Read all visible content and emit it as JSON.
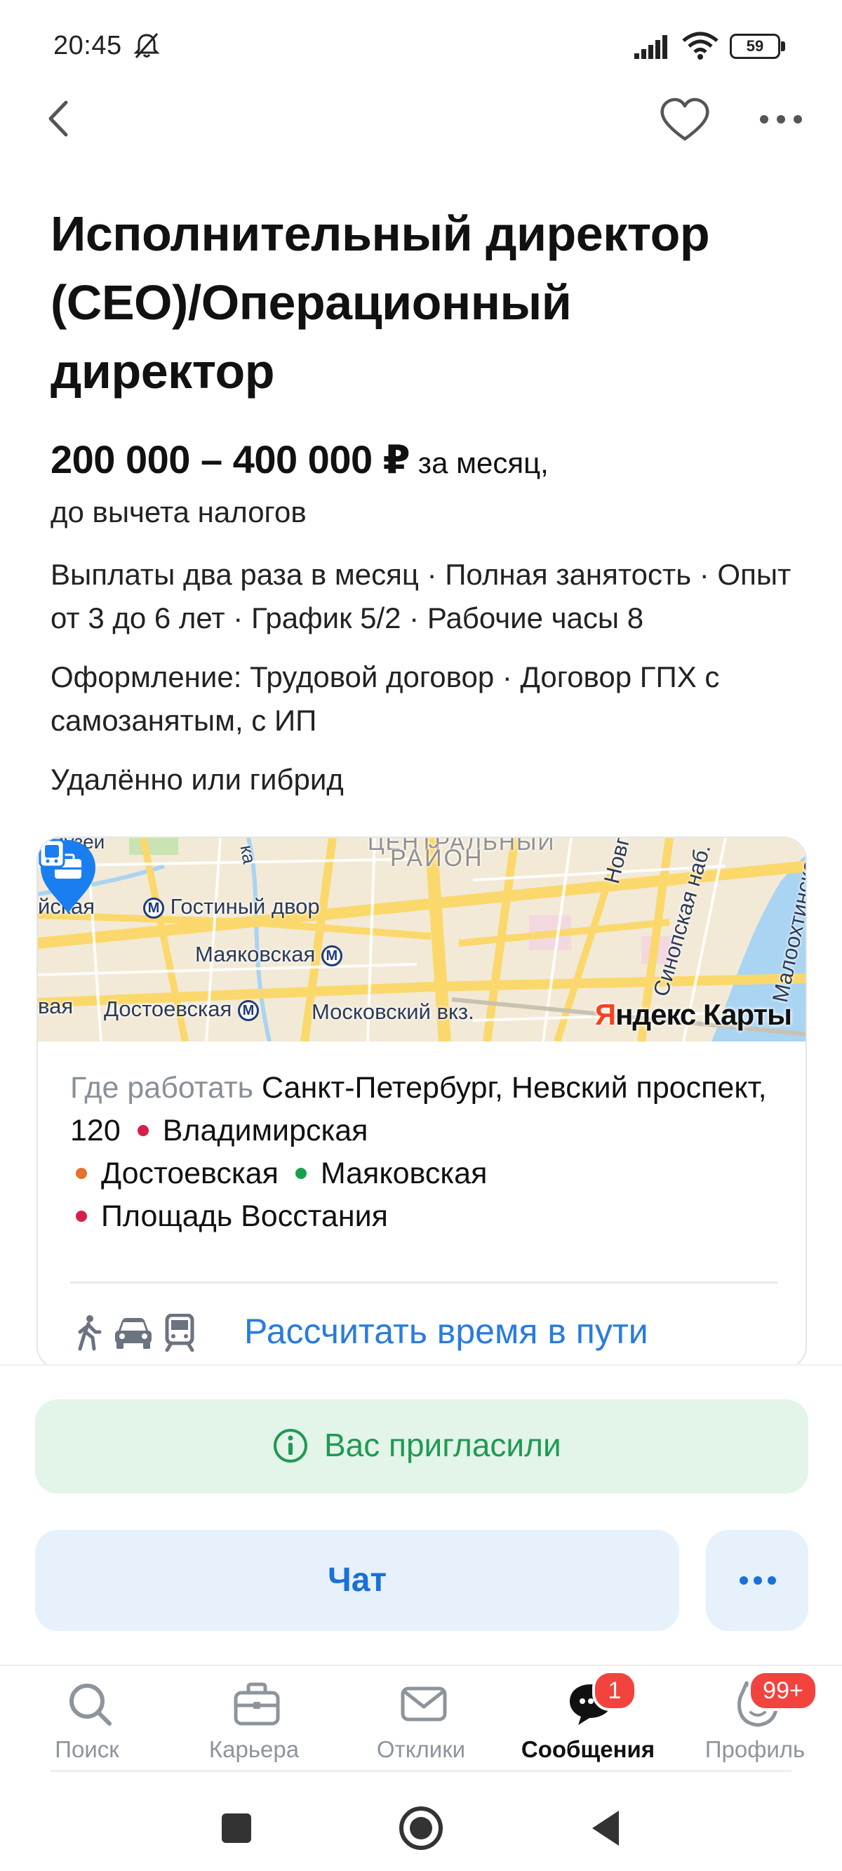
{
  "status_bar": {
    "time": "20:45",
    "battery": "59",
    "icons": [
      "bell-off-icon",
      "signal-icon",
      "wifi-icon",
      "battery-icon"
    ]
  },
  "nav": {
    "back_icon": "chevron-left-icon",
    "favorite_icon": "heart-icon",
    "more_icon": "more-dots-icon"
  },
  "vacancy": {
    "title": "Исполнительный директор (CEO)/Операционный директор",
    "salary_amount": "200 000 – 400 000 ₽",
    "salary_period": " за месяц,",
    "salary_note": "до вычета налогов",
    "terms": "Выплаты два раза в месяц · Полная занятость · Опыт от 3 до 6 лет · График 5/2 · Рабочие часы 8",
    "employment": "Оформление: Трудовой договор · Договор ГПХ с самозанятым, с ИП",
    "work_format": "Удалённо или гибрид"
  },
  "map": {
    "provider": "Яндекс Карты",
    "provider_ya": "Я",
    "provider_rest": "ндекс Карты",
    "labels": {
      "museum": "музей",
      "district": "РАЙОН",
      "district_top": "ЦЕНТРАЛЬНЫЙ",
      "gostiny": "Гостиный двор",
      "sennaya": "йская",
      "mayakovskaya": "Маяковская",
      "dostoevskaya": "Достоевская",
      "vaya": "вая",
      "moskovsky": "Московский вкз.",
      "novgorodskaya": "Новгород",
      "sinopskaya": "Синопская наб.",
      "malookhtinsky": "Малоохтинская",
      "fontanka": "ка"
    }
  },
  "address": {
    "label": "Где работать",
    "text": " Санкт-Петербург, Невский проспект, 120",
    "stations": [
      {
        "name": "Владимирская",
        "color": "#d6204a"
      },
      {
        "name": "Достоевская",
        "color": "#e6702f"
      },
      {
        "name": "Маяковская",
        "color": "#18a04f"
      },
      {
        "name": "Площадь Восстания",
        "color": "#d6204a"
      }
    ],
    "route_link": "Рассчитать время в пути",
    "route_icons": [
      "walk-icon",
      "car-icon",
      "transit-icon"
    ]
  },
  "actions": {
    "invited": "Вас пригласили",
    "chat": "Чат"
  },
  "tabs": [
    {
      "label": "Поиск",
      "icon": "search-icon",
      "active": false
    },
    {
      "label": "Карьера",
      "icon": "briefcase-icon",
      "active": false
    },
    {
      "label": "Отклики",
      "icon": "mail-icon",
      "active": false
    },
    {
      "label": "Сообщения",
      "icon": "chat-bubble-icon",
      "active": true,
      "badge": "1"
    },
    {
      "label": "Профиль",
      "icon": "profile-icon",
      "active": false,
      "badge": "99+"
    }
  ],
  "colors": {
    "accent": "#2a7be0",
    "success": "#1f9a52",
    "badge": "#f2433f"
  }
}
